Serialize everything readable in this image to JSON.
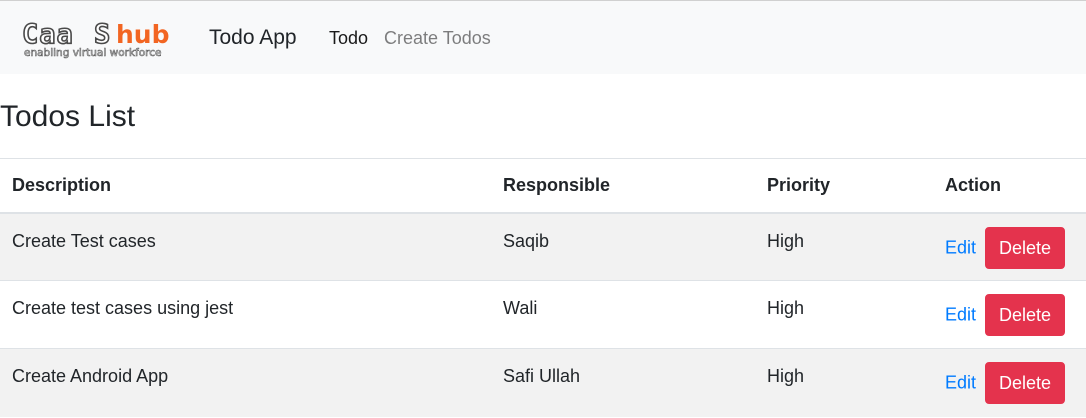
{
  "navbar": {
    "logo_text": "CaaShub",
    "logo_tagline": "enabling virtual workforce",
    "brand": "Todo App",
    "links": [
      {
        "label": "Todo"
      },
      {
        "label": "Create Todos"
      }
    ]
  },
  "main": {
    "title": "Todos List",
    "table": {
      "headers": [
        "Description",
        "Responsible",
        "Priority",
        "Action"
      ],
      "rows": [
        {
          "description": "Create Test cases",
          "responsible": "Saqib",
          "priority": "High",
          "edit_label": "Edit",
          "delete_label": "Delete"
        },
        {
          "description": "Create test cases using jest",
          "responsible": "Wali",
          "priority": "High",
          "edit_label": "Edit",
          "delete_label": "Delete"
        },
        {
          "description": "Create Android App",
          "responsible": "Safi Ullah",
          "priority": "High",
          "edit_label": "Edit",
          "delete_label": "Delete"
        }
      ]
    }
  },
  "colors": {
    "navbar_bg": "#f8f9fa",
    "link_blue": "#007bff",
    "danger_red": "#e4334d",
    "logo_orange": "#f26522"
  }
}
